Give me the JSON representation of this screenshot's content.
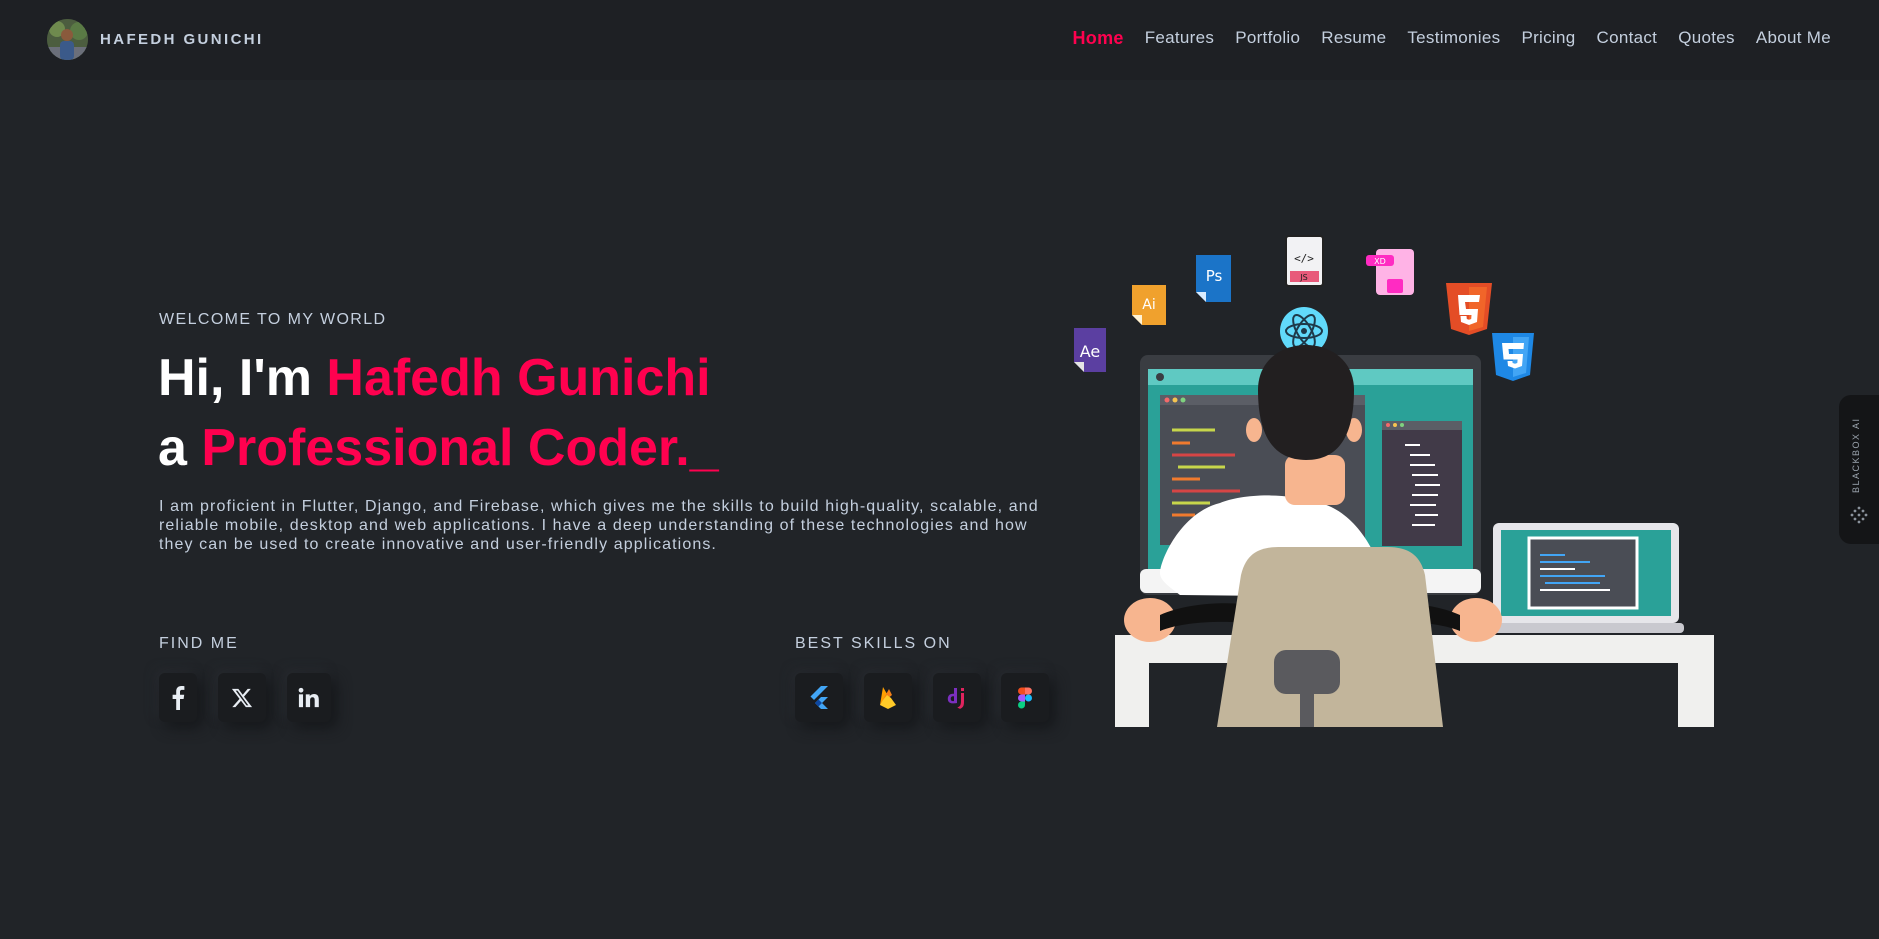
{
  "header": {
    "brand_name": "HAFEDH GUNICHI",
    "nav": [
      {
        "label": "Home",
        "active": true
      },
      {
        "label": "Features"
      },
      {
        "label": "Portfolio"
      },
      {
        "label": "Resume"
      },
      {
        "label": "Testimonies"
      },
      {
        "label": "Pricing"
      },
      {
        "label": "Contact"
      },
      {
        "label": "Quotes"
      },
      {
        "label": "About Me"
      }
    ]
  },
  "hero": {
    "kicker": "WELCOME TO MY WORLD",
    "line1_prefix": "Hi, I'm ",
    "line1_name": "Hafedh Gunichi",
    "line2_prefix": "a ",
    "line2_role": "Professional Coder._",
    "description": "I am proficient in Flutter, Django, and Firebase, which gives me the skills to build high-quality, scalable, and reliable mobile, desktop and web applications. I have a deep understanding of these technologies and how they can be used to create innovative and user-friendly applications."
  },
  "find_me": {
    "label": "FIND ME",
    "icons": [
      "facebook-icon",
      "x-twitter-icon",
      "linkedin-icon"
    ]
  },
  "skills": {
    "label": "BEST SKILLS ON",
    "icons": [
      "flutter-icon",
      "firebase-icon",
      "django-icon",
      "figma-icon"
    ]
  },
  "blackbox": {
    "label": "BLACKBOX AI"
  },
  "illustration": {
    "badge_labels": {
      "ae": "Ae",
      "ai": "Ai",
      "ps": "Ps",
      "js": "JS",
      "xd": "XD"
    }
  },
  "colors": {
    "accent": "#ff014f",
    "background": "#212428",
    "header": "#1e2024",
    "text": "#c4cfde"
  }
}
